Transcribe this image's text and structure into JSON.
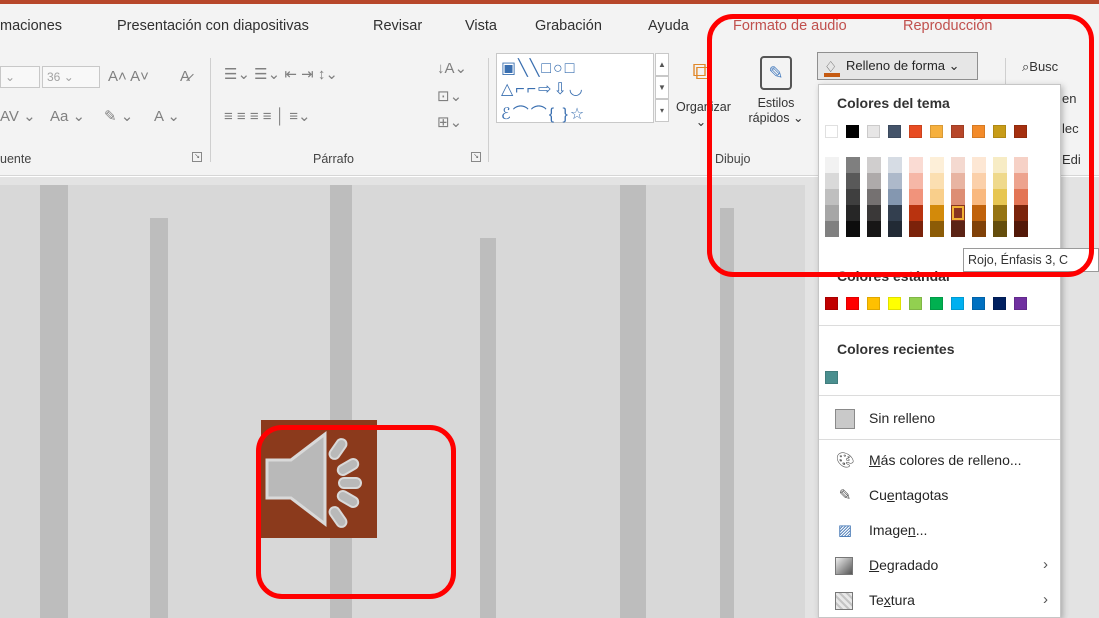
{
  "tabs": [
    {
      "label": "maciones",
      "x": 0
    },
    {
      "label": "Presentación con diapositivas"
    },
    {
      "label": "Revisar"
    },
    {
      "label": "Vista"
    },
    {
      "label": "Grabación"
    },
    {
      "label": "Ayuda"
    }
  ],
  "context_tabs": [
    "Formato de audio",
    "Reproducción"
  ],
  "search_label": "Busc",
  "font_group": {
    "size_value": "36",
    "label": "uente"
  },
  "paragraph_group": {
    "label": "Párrafo"
  },
  "drawing_group": {
    "label": "Dibujo",
    "organize_label": "Organizar",
    "styles_label_1": "Estilos",
    "styles_label_2": "rápidos"
  },
  "fill_button": {
    "label": "Relleno de forma"
  },
  "right_partial": {
    "line1": "en",
    "line2": "lec",
    "line3": "Edi"
  },
  "dropdown": {
    "theme_colors_title": "Colores del tema",
    "standard_colors_title": "Colores estándar",
    "recent_colors_title": "Colores recientes",
    "theme_top_row": [
      "#ffffff",
      "#000000",
      "#e7e6e6",
      "#44546a",
      "#e84c22",
      "#f6b03e",
      "#b7472a",
      "#f38b2a",
      "#c89c18",
      "#a5300f"
    ],
    "theme_shades": [
      [
        "#f2f2f2",
        "#d9d9d9",
        "#bfbfbf",
        "#a6a6a6",
        "#808080"
      ],
      [
        "#7f7f7f",
        "#595959",
        "#3f3f3f",
        "#262626",
        "#0d0d0d"
      ],
      [
        "#d0cece",
        "#aeaaaa",
        "#757171",
        "#3a3838",
        "#171616"
      ],
      [
        "#d6dce4",
        "#adb9ca",
        "#8497b0",
        "#333f4f",
        "#222a35"
      ],
      [
        "#fadbd3",
        "#f6b7a7",
        "#f1937b",
        "#b9330f",
        "#7b220a"
      ],
      [
        "#fdefd8",
        "#fbdfb1",
        "#f9cf8b",
        "#d38a0a",
        "#8c5c07"
      ],
      [
        "#f4d9d0",
        "#e8b4a2",
        "#dd8e74",
        "#893520",
        "#5b2315"
      ],
      [
        "#fde7d4",
        "#fbd0aa",
        "#f9b97f",
        "#c0620b",
        "#804108"
      ],
      [
        "#f7ecc5",
        "#efd98c",
        "#e7c652",
        "#967412",
        "#644d0c"
      ],
      [
        "#f6d1c6",
        "#eda38e",
        "#e37555",
        "#7b240b",
        "#521808"
      ]
    ],
    "standard_colors": [
      "#c00000",
      "#ff0000",
      "#ffc000",
      "#ffff00",
      "#92d050",
      "#00b050",
      "#00b0f0",
      "#0070c0",
      "#002060",
      "#7030a0"
    ],
    "recent_colors": [
      "#4a8f8f"
    ],
    "no_fill": "Sin relleno",
    "no_fill_ul": "o",
    "more_colors_ul": "M",
    "more_colors_rest": "ás colores de relleno...",
    "eyedropper_a": "Cu",
    "eyedropper_ul": "e",
    "eyedropper_b": "ntagotas",
    "image_a": "Image",
    "image_ul": "n",
    "image_b": "...",
    "gradient_ul": "D",
    "gradient_rest": "egradado",
    "texture_a": "Te",
    "texture_ul": "x",
    "texture_b": "tura"
  },
  "tooltip": "Rojo, Énfasis 3, C",
  "colors": {
    "accent": "#b7472a",
    "annotation": "#ff0000",
    "audio_icon_bg": "#8b3a1c"
  }
}
